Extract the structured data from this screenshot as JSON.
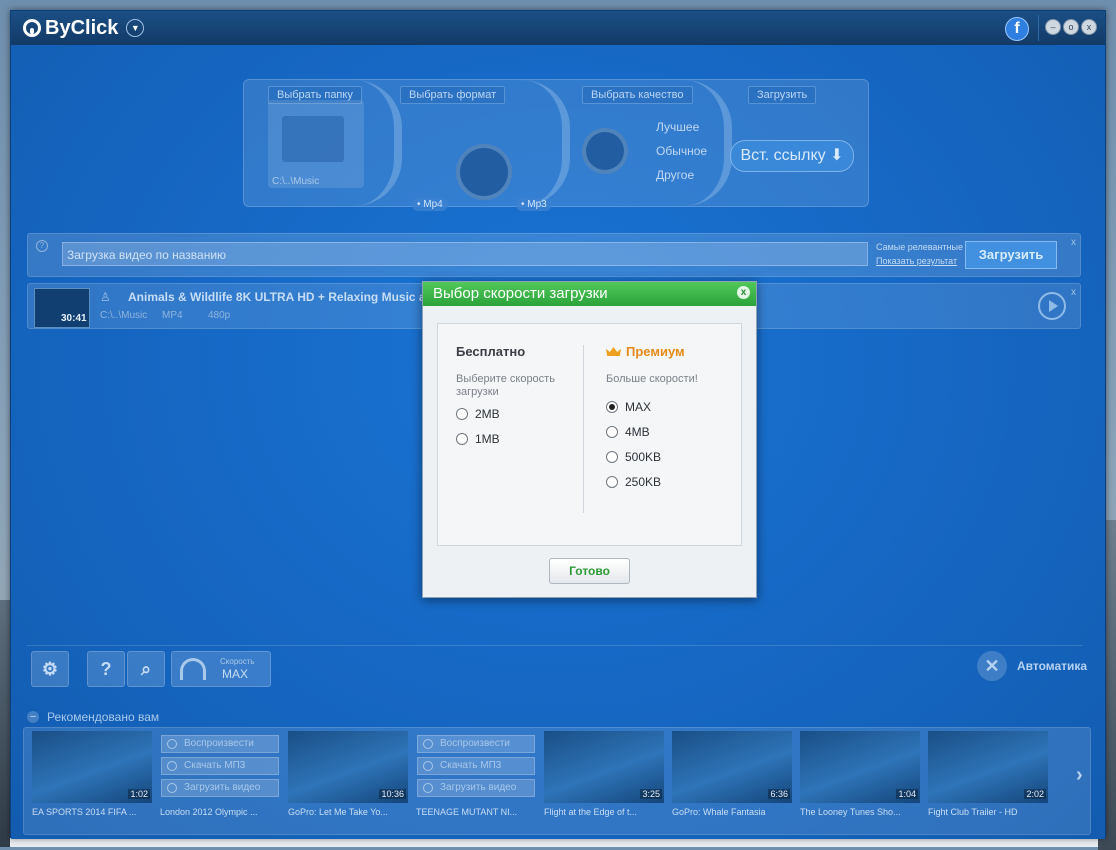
{
  "app": {
    "name": "ByClick"
  },
  "title_bar": {
    "facebook": "f",
    "min": "–",
    "max": "o",
    "close": "x"
  },
  "wizard": {
    "steps": [
      "Выбрать папку",
      "Выбрать формат",
      "Выбрать качество",
      "Загрузить"
    ],
    "folder_path": "C:\\..\\Music",
    "formats": [
      "• Mp4",
      "• Mp3"
    ],
    "quality_options": [
      "Лучшее",
      "Обычное",
      "Другое"
    ],
    "paste_button": "Вст. ссылку"
  },
  "search": {
    "placeholder": "Загрузка видео по названию",
    "sort_options": [
      "Самые релевантные",
      "Показать результат"
    ],
    "button": "Загрузить",
    "help": "?",
    "close": "x"
  },
  "download_item": {
    "duration": "30:41",
    "title": "Animals & Wildlife 8K ULTRA HD + Relaxing Music a",
    "path": "C:\\..\\Music",
    "format": "MP4",
    "quality": "480p"
  },
  "dialog": {
    "title": "Выбор скорости загрузки",
    "close": "x",
    "free": {
      "heading": "Бесплатно",
      "subtitle": "Выберите скорость загрузки",
      "options": [
        "2MB",
        "1MB"
      ]
    },
    "premium": {
      "heading": "Премиум",
      "subtitle": "Больше скорости!",
      "options": [
        "MAX",
        "4MB",
        "500KB",
        "250KB"
      ],
      "selected": "MAX"
    },
    "done_button": "Готово"
  },
  "toolbar": {
    "settings": "⚙",
    "help": "?",
    "search": "⌕",
    "speed_label": "Скорость",
    "speed_value": "MAX",
    "auto_label": "Автоматика"
  },
  "recommended": {
    "heading": "Рекомендовано вам",
    "toggle": "–",
    "actions": [
      "Воспроизвести",
      "Скачать МП3",
      "Загрузить видео"
    ],
    "videos": [
      {
        "title": "EA SPORTS 2014 FIFA ...",
        "duration": "1:02"
      },
      {
        "title": "London 2012 Olympic ...",
        "duration": ""
      },
      {
        "title": "GoPro: Let Me Take Yo...",
        "duration": "10:36"
      },
      {
        "title": "TEENAGE MUTANT NI...",
        "duration": ""
      },
      {
        "title": "Flight at the Edge of t...",
        "duration": "3:25"
      },
      {
        "title": "GoPro: Whale Fantasia",
        "duration": "6:36"
      },
      {
        "title": "The Looney Tunes Sho...",
        "duration": "1:04"
      },
      {
        "title": "Fight Club Trailer - HD",
        "duration": "2:02"
      }
    ]
  }
}
